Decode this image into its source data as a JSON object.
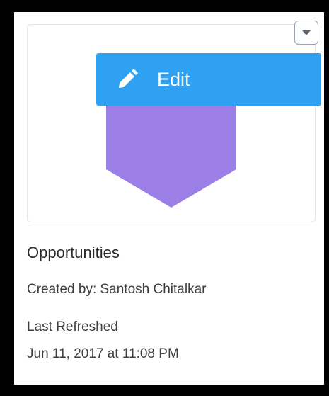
{
  "card": {
    "title": "Opportunities",
    "created_by": "Created by: Santosh Chitalkar",
    "last_refreshed_label": "Last Refreshed",
    "last_refreshed_value": "Jun 11, 2017 at 11:08 PM"
  },
  "menu": {
    "toggle_icon": "chevron-down-icon",
    "items": [
      {
        "label": "Edit",
        "icon": "pencil-icon"
      }
    ]
  },
  "thumbnail": {
    "shape": "funnel",
    "color": "#9c7fe6"
  },
  "colors": {
    "menu_item_bg": "#2fa1f3",
    "menu_item_text": "#ffffff",
    "frame": "#000000"
  }
}
